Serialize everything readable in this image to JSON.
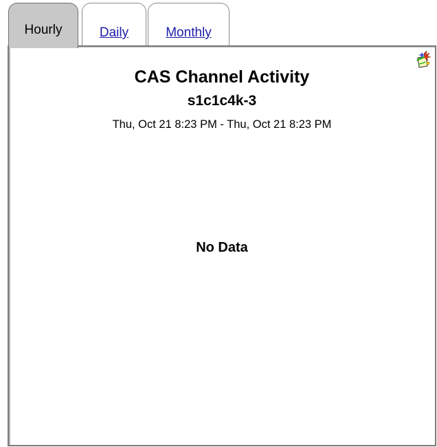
{
  "tabs": [
    {
      "label": "Hourly",
      "active": true
    },
    {
      "label": "Daily",
      "active": false
    },
    {
      "label": "Monthly",
      "active": false
    }
  ],
  "chart": {
    "title": "CAS Channel Activity",
    "subtitle": "s1c1c4k-3",
    "time_range": "Thu, Oct 21 8:23 PM - Thu, Oct 21 8:23 PM",
    "message": "No Data"
  },
  "icons": {
    "export": "export-icon"
  },
  "colors": {
    "active_tab_bg": "#c8c8c8",
    "link": "#1c1ca8",
    "border": "#7a7a7a"
  }
}
